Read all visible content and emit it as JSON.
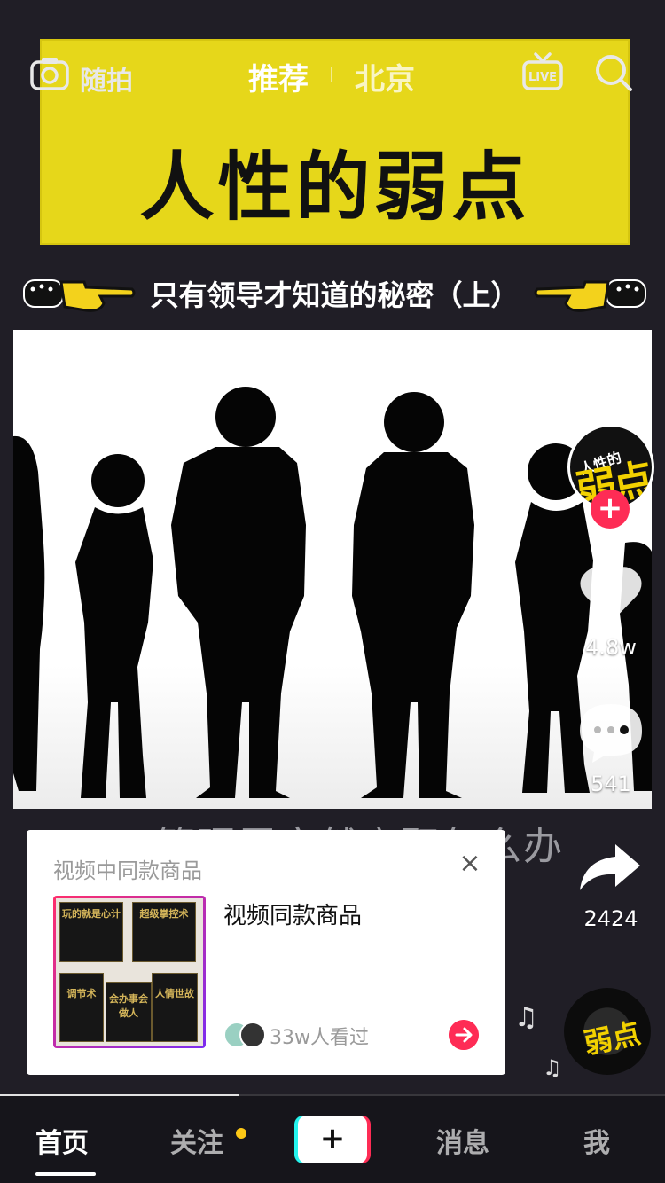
{
  "top_nav": {
    "shoot_label": "随拍",
    "tabs": [
      {
        "label": "推荐",
        "active": true
      },
      {
        "label": "北京",
        "active": false
      }
    ],
    "icons": [
      "camera-icon",
      "live-icon",
      "search-icon"
    ]
  },
  "video": {
    "banner_title": "人性的弱点",
    "subtitle": "只有领导才知道的秘密（上）",
    "caption_ghost": "2.管理层突然离职怎么办"
  },
  "creator": {
    "avatar_text_small": "人性的",
    "avatar_text_large": "弱点",
    "follow_symbol": "+"
  },
  "actions": {
    "likes": "4.8w",
    "comments": "541",
    "shares": "2424"
  },
  "music": {
    "disc_text": "弱点",
    "note_symbol": "♫"
  },
  "product_card": {
    "header": "视频中同款商品",
    "close_symbol": "×",
    "title": "视频同款商品",
    "viewers_text": "33w人看过",
    "books": [
      {
        "text": "玩的就是心计"
      },
      {
        "text": "超级掌控术"
      },
      {
        "text": "调节术"
      },
      {
        "text": "会办事会做人"
      },
      {
        "text": "人情世故"
      }
    ]
  },
  "bottom_nav": {
    "items": [
      {
        "label": "首页",
        "active": true
      },
      {
        "label": "关注",
        "active": false,
        "badge_dot": true
      },
      {
        "label": "消息",
        "active": false
      },
      {
        "label": "我",
        "active": false
      }
    ],
    "create_symbol": "+",
    "progress": 0.36
  },
  "colors": {
    "accent_red": "#fe2c55",
    "accent_cyan": "#25f4ee",
    "banner_yellow": "#e6d71a",
    "badge_yellow": "#fdc816"
  }
}
